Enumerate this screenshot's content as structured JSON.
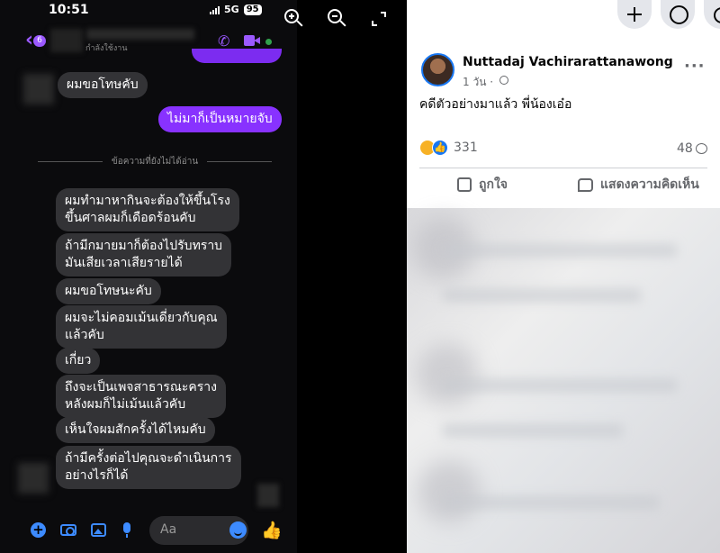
{
  "chat": {
    "status_bar": {
      "time": "10:51",
      "network": "5G",
      "battery": "95"
    },
    "header": {
      "back_count": "6",
      "contact_status": "กำลังใช้งาน"
    },
    "messages_top": [
      {
        "direction": "in",
        "text": "ผมขอโทษคับ"
      },
      {
        "direction": "out",
        "text": "ไม่มาก็เป็นหมายจับ"
      }
    ],
    "unread_separator": "ข้อความที่ยังไม่ได้อ่าน",
    "messages_unread": [
      {
        "direction": "in",
        "text": "ผมทำมาหากินจะต้องให้ขึ้นโรง\nขึ้นศาลผมก็เดือดร้อนคับ"
      },
      {
        "direction": "in",
        "text": "ถ้ามีกมายมาก็ต้องไปรับทราบ\nมันเสียเวลาเสียรายได้"
      },
      {
        "direction": "in",
        "text": "ผมขอโทษนะคับ"
      },
      {
        "direction": "in",
        "text": "ผมจะไม่คอมเม้นเดี่ยวกับคุณ\nแล้วคับ"
      },
      {
        "direction": "in",
        "text": "เกี่ยว"
      },
      {
        "direction": "in",
        "text": "ถึงจะเป็นเพจสาธารณะคราง\nหลังผมก็ไม่เม้นแล้วคับ"
      },
      {
        "direction": "in",
        "text": "เห็นใจผมสักครั้งได้ไหมคับ"
      },
      {
        "direction": "in",
        "text": "ถ้ามีครั้งต่อไปคุณจะดำเนินการ\nอย่างไรก็ได้"
      }
    ],
    "composer": {
      "placeholder": "Aa"
    }
  },
  "viewer": {
    "icons": [
      "zoom-in-icon",
      "zoom-out-icon",
      "expand-icon"
    ]
  },
  "post": {
    "author": "Nuttadaj Vachirarattanawong",
    "time": "1 วัน ·",
    "text": "คดีตัวอย่างมาแล้ว พี่น้องเอ๋อ",
    "reaction_count": "331",
    "comment_count": "48",
    "actions": {
      "like": "ถูกใจ",
      "comment": "แสดงความคิดเห็น"
    }
  },
  "colors": {
    "messenger_accent": "#8832ff",
    "incoming_bubble": "#333336",
    "facebook_blue": "#1877f2"
  }
}
